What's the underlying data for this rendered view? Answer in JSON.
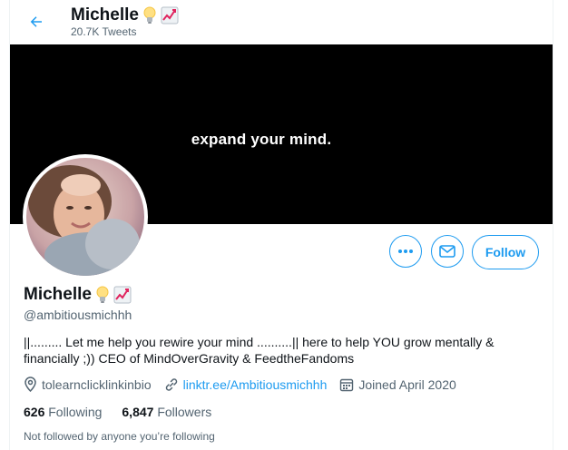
{
  "colors": {
    "accent": "#1d9bf0",
    "text": "#0f1419",
    "muted": "#536471",
    "banner": "#000000"
  },
  "header": {
    "name": "Michelle",
    "tweet_count": "20.7K Tweets",
    "back_icon": "arrow-left-icon"
  },
  "banner": {
    "text": "expand your mind."
  },
  "profile": {
    "name": "Michelle",
    "handle": "@ambitiousmichhh",
    "name_emojis": [
      "lightbulb-icon",
      "chart-increasing-icon"
    ],
    "bio_line1": "||......... Let me help you rewire your mind ..........|| here to help YOU grow mentally &",
    "bio_line2": "financially ;)) CEO of MindOverGravity & FeedtheFandoms",
    "location": "tolearnclicklinkinbio",
    "website": "linktr.ee/Ambitiousmichhh",
    "joined": "Joined April 2020"
  },
  "actions": {
    "more_icon": "more-icon",
    "message_icon": "envelope-icon",
    "follow_label": "Follow"
  },
  "stats": {
    "following_count": "626",
    "following_label": "Following",
    "followers_count": "6,847",
    "followers_label": "Followers"
  },
  "followed_by": "Not followed by anyone you’re following"
}
